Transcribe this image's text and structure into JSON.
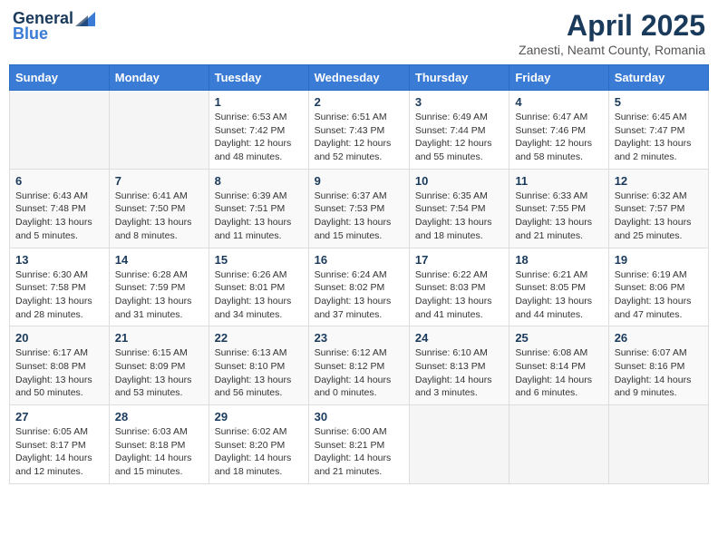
{
  "header": {
    "logo_general": "General",
    "logo_blue": "Blue",
    "month_title": "April 2025",
    "location": "Zanesti, Neamt County, Romania"
  },
  "weekdays": [
    "Sunday",
    "Monday",
    "Tuesday",
    "Wednesday",
    "Thursday",
    "Friday",
    "Saturday"
  ],
  "weeks": [
    [
      {
        "day": "",
        "info": ""
      },
      {
        "day": "",
        "info": ""
      },
      {
        "day": "1",
        "info": "Sunrise: 6:53 AM\nSunset: 7:42 PM\nDaylight: 12 hours and 48 minutes."
      },
      {
        "day": "2",
        "info": "Sunrise: 6:51 AM\nSunset: 7:43 PM\nDaylight: 12 hours and 52 minutes."
      },
      {
        "day": "3",
        "info": "Sunrise: 6:49 AM\nSunset: 7:44 PM\nDaylight: 12 hours and 55 minutes."
      },
      {
        "day": "4",
        "info": "Sunrise: 6:47 AM\nSunset: 7:46 PM\nDaylight: 12 hours and 58 minutes."
      },
      {
        "day": "5",
        "info": "Sunrise: 6:45 AM\nSunset: 7:47 PM\nDaylight: 13 hours and 2 minutes."
      }
    ],
    [
      {
        "day": "6",
        "info": "Sunrise: 6:43 AM\nSunset: 7:48 PM\nDaylight: 13 hours and 5 minutes."
      },
      {
        "day": "7",
        "info": "Sunrise: 6:41 AM\nSunset: 7:50 PM\nDaylight: 13 hours and 8 minutes."
      },
      {
        "day": "8",
        "info": "Sunrise: 6:39 AM\nSunset: 7:51 PM\nDaylight: 13 hours and 11 minutes."
      },
      {
        "day": "9",
        "info": "Sunrise: 6:37 AM\nSunset: 7:53 PM\nDaylight: 13 hours and 15 minutes."
      },
      {
        "day": "10",
        "info": "Sunrise: 6:35 AM\nSunset: 7:54 PM\nDaylight: 13 hours and 18 minutes."
      },
      {
        "day": "11",
        "info": "Sunrise: 6:33 AM\nSunset: 7:55 PM\nDaylight: 13 hours and 21 minutes."
      },
      {
        "day": "12",
        "info": "Sunrise: 6:32 AM\nSunset: 7:57 PM\nDaylight: 13 hours and 25 minutes."
      }
    ],
    [
      {
        "day": "13",
        "info": "Sunrise: 6:30 AM\nSunset: 7:58 PM\nDaylight: 13 hours and 28 minutes."
      },
      {
        "day": "14",
        "info": "Sunrise: 6:28 AM\nSunset: 7:59 PM\nDaylight: 13 hours and 31 minutes."
      },
      {
        "day": "15",
        "info": "Sunrise: 6:26 AM\nSunset: 8:01 PM\nDaylight: 13 hours and 34 minutes."
      },
      {
        "day": "16",
        "info": "Sunrise: 6:24 AM\nSunset: 8:02 PM\nDaylight: 13 hours and 37 minutes."
      },
      {
        "day": "17",
        "info": "Sunrise: 6:22 AM\nSunset: 8:03 PM\nDaylight: 13 hours and 41 minutes."
      },
      {
        "day": "18",
        "info": "Sunrise: 6:21 AM\nSunset: 8:05 PM\nDaylight: 13 hours and 44 minutes."
      },
      {
        "day": "19",
        "info": "Sunrise: 6:19 AM\nSunset: 8:06 PM\nDaylight: 13 hours and 47 minutes."
      }
    ],
    [
      {
        "day": "20",
        "info": "Sunrise: 6:17 AM\nSunset: 8:08 PM\nDaylight: 13 hours and 50 minutes."
      },
      {
        "day": "21",
        "info": "Sunrise: 6:15 AM\nSunset: 8:09 PM\nDaylight: 13 hours and 53 minutes."
      },
      {
        "day": "22",
        "info": "Sunrise: 6:13 AM\nSunset: 8:10 PM\nDaylight: 13 hours and 56 minutes."
      },
      {
        "day": "23",
        "info": "Sunrise: 6:12 AM\nSunset: 8:12 PM\nDaylight: 14 hours and 0 minutes."
      },
      {
        "day": "24",
        "info": "Sunrise: 6:10 AM\nSunset: 8:13 PM\nDaylight: 14 hours and 3 minutes."
      },
      {
        "day": "25",
        "info": "Sunrise: 6:08 AM\nSunset: 8:14 PM\nDaylight: 14 hours and 6 minutes."
      },
      {
        "day": "26",
        "info": "Sunrise: 6:07 AM\nSunset: 8:16 PM\nDaylight: 14 hours and 9 minutes."
      }
    ],
    [
      {
        "day": "27",
        "info": "Sunrise: 6:05 AM\nSunset: 8:17 PM\nDaylight: 14 hours and 12 minutes."
      },
      {
        "day": "28",
        "info": "Sunrise: 6:03 AM\nSunset: 8:18 PM\nDaylight: 14 hours and 15 minutes."
      },
      {
        "day": "29",
        "info": "Sunrise: 6:02 AM\nSunset: 8:20 PM\nDaylight: 14 hours and 18 minutes."
      },
      {
        "day": "30",
        "info": "Sunrise: 6:00 AM\nSunset: 8:21 PM\nDaylight: 14 hours and 21 minutes."
      },
      {
        "day": "",
        "info": ""
      },
      {
        "day": "",
        "info": ""
      },
      {
        "day": "",
        "info": ""
      }
    ]
  ]
}
